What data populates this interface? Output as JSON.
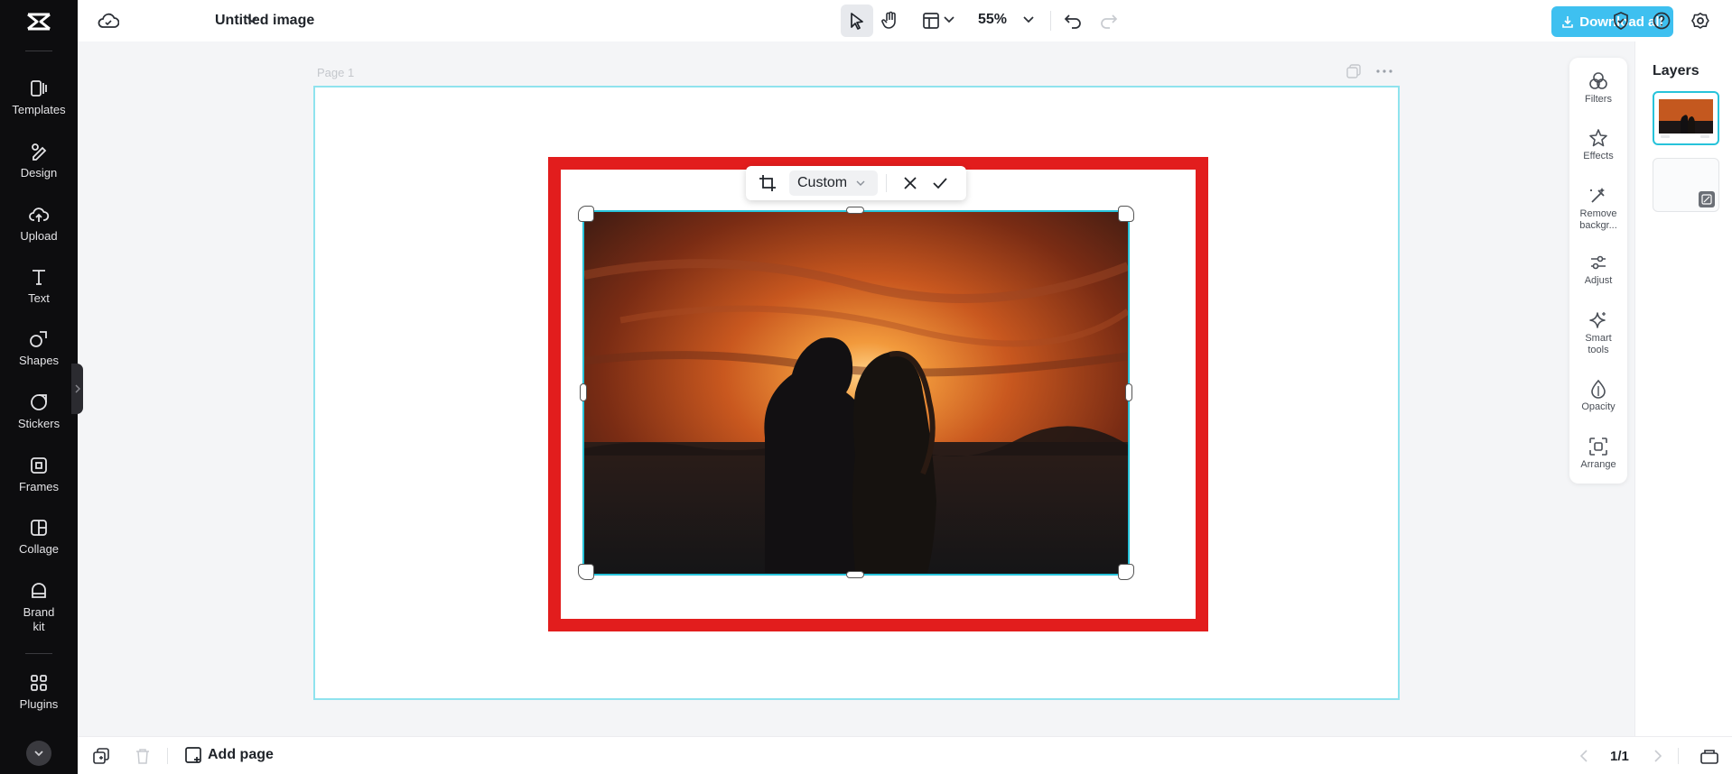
{
  "colors": {
    "accent": "#3ec0f0",
    "selection": "#27c3da",
    "frame_red": "#e21d1d",
    "rail_bg": "#0d0d0f"
  },
  "sidebar": {
    "items": [
      {
        "label": "Templates",
        "icon": "templates-icon"
      },
      {
        "label": "Design",
        "icon": "design-icon"
      },
      {
        "label": "Upload",
        "icon": "upload-icon"
      },
      {
        "label": "Text",
        "icon": "text-icon"
      },
      {
        "label": "Shapes",
        "icon": "shapes-icon"
      },
      {
        "label": "Stickers",
        "icon": "stickers-icon"
      },
      {
        "label": "Frames",
        "icon": "frames-icon"
      },
      {
        "label": "Collage",
        "icon": "collage-icon"
      },
      {
        "label": "Brand kit",
        "icon": "brand-kit-icon"
      },
      {
        "label": "Plugins",
        "icon": "plugins-icon"
      }
    ]
  },
  "header": {
    "title": "Untitled image",
    "zoom": "55%",
    "download_label": "Download all"
  },
  "canvas": {
    "page_label": "Page 1",
    "crop_ratio": "Custom"
  },
  "tools": {
    "items": [
      {
        "label": "Filters",
        "icon": "filters-icon"
      },
      {
        "label": "Effects",
        "icon": "effects-icon"
      },
      {
        "label": "Remove backgr...",
        "icon": "remove-background-icon"
      },
      {
        "label": "Adjust",
        "icon": "adjust-icon"
      },
      {
        "label": "Smart tools",
        "icon": "smart-tools-icon"
      },
      {
        "label": "Opacity",
        "icon": "opacity-icon"
      },
      {
        "label": "Arrange",
        "icon": "arrange-icon"
      }
    ]
  },
  "layers": {
    "title": "Layers"
  },
  "footer": {
    "add_page_label": "Add page",
    "page_count": "1/1"
  }
}
